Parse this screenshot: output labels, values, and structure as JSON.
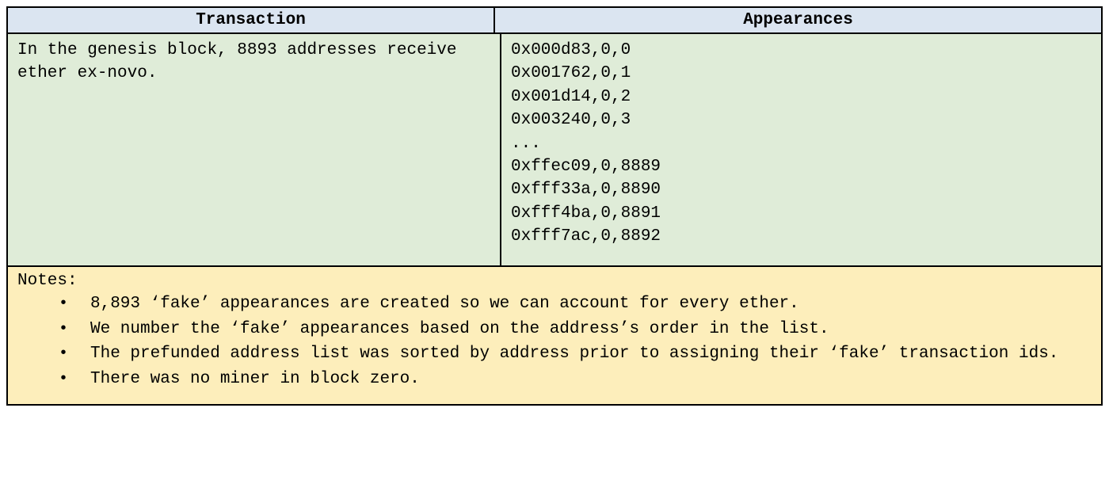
{
  "headers": {
    "left": "Transaction",
    "right": "Appearances"
  },
  "transaction_text": "In the genesis block, 8893 addresses receive ether ex-novo.",
  "appearances": [
    "0x000d83,0,0",
    "0x001762,0,1",
    "0x001d14,0,2",
    "0x003240,0,3",
    "...",
    "0xffec09,0,8889",
    "0xfff33a,0,8890",
    "0xfff4ba,0,8891",
    "0xfff7ac,0,8892"
  ],
  "notes_label": "Notes:",
  "notes": [
    "8,893 ‘fake’ appearances are created so we can account for every ether.",
    "We number the ‘fake’ appearances based on the address’s order in the list.",
    "The prefunded address list was sorted by address prior to assigning their ‘fake’ transaction ids.",
    "There was no miner in block zero."
  ]
}
